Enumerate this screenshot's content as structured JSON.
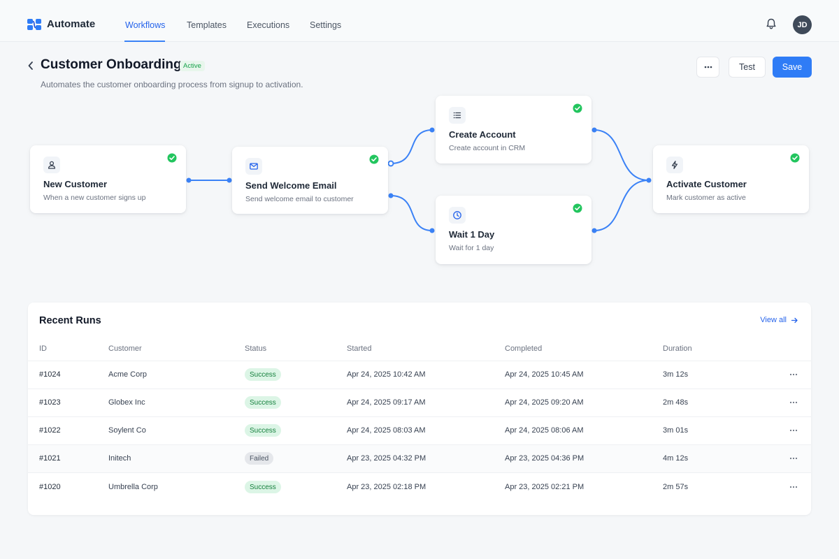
{
  "app": {
    "name": "Automate",
    "logo_icon": "automate-logo-icon",
    "nav": [
      {
        "label": "Workflows",
        "active": true
      },
      {
        "label": "Templates",
        "active": false
      },
      {
        "label": "Executions",
        "active": false
      },
      {
        "label": "Settings",
        "active": false
      }
    ],
    "bell_icon": "bell-icon",
    "avatar_initials": "JD"
  },
  "header": {
    "title": "Customer Onboarding",
    "status": "Active",
    "description": "Automates the customer onboarding process from signup to activation.",
    "more_icon": "more-horizontal-icon",
    "test_label": "Test",
    "save_label": "Save"
  },
  "workflow": {
    "nodes": [
      {
        "title": "New Customer",
        "description": "When a new customer signs up",
        "icon": "user-icon",
        "status": "success"
      },
      {
        "title": "Send Welcome Email",
        "description": "Send welcome email to customer",
        "icon": "mail-icon",
        "status": "success"
      },
      {
        "title": "Create Account",
        "description": "Create account in CRM",
        "icon": "list-icon",
        "status": "success"
      },
      {
        "title": "Wait 1 Day",
        "description": "Wait for 1 day",
        "icon": "clock-icon",
        "status": "success"
      },
      {
        "title": "Activate Customer",
        "description": "Mark customer as active",
        "icon": "bolt-icon",
        "status": "success"
      }
    ]
  },
  "runs": {
    "title": "Recent Runs",
    "view_all": "View all",
    "columns": [
      "ID",
      "Customer",
      "Status",
      "Started",
      "Completed",
      "Duration"
    ],
    "rows": [
      {
        "id": "#1024",
        "customer": "Acme Corp",
        "status": "Success",
        "started": "Apr 24, 2025 10:42 AM",
        "completed": "Apr 24, 2025 10:45 AM",
        "duration": "3m 12s"
      },
      {
        "id": "#1023",
        "customer": "Globex Inc",
        "status": "Success",
        "started": "Apr 24, 2025 09:17 AM",
        "completed": "Apr 24, 2025 09:20 AM",
        "duration": "2m 48s"
      },
      {
        "id": "#1022",
        "customer": "Soylent Co",
        "status": "Success",
        "started": "Apr 24, 2025 08:03 AM",
        "completed": "Apr 24, 2025 08:06 AM",
        "duration": "3m 01s"
      },
      {
        "id": "#1021",
        "customer": "Initech",
        "status": "Failed",
        "started": "Apr 23, 2025 04:32 PM",
        "completed": "Apr 23, 2025 04:36 PM",
        "duration": "4m 12s"
      },
      {
        "id": "#1020",
        "customer": "Umbrella Corp",
        "status": "Success",
        "started": "Apr 23, 2025 02:18 PM",
        "completed": "Apr 23, 2025 02:21 PM",
        "duration": "2m 57s"
      }
    ]
  },
  "colors": {
    "accent": "#2f7cf6",
    "success": "#22c55e",
    "edge": "#3b82f6"
  }
}
